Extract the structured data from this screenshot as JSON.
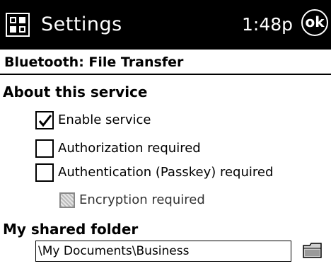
{
  "titlebar": {
    "start_icon": "start-menu-icon",
    "title": "Settings",
    "time": "1:48p",
    "ok_label": "ok"
  },
  "subtitle": "Bluetooth: File Transfer",
  "about": {
    "heading": "About this service",
    "options": [
      {
        "label": "Enable service",
        "checked": true,
        "enabled": true
      },
      {
        "label": "Authorization required",
        "checked": false,
        "enabled": true
      },
      {
        "label": "Authentication (Passkey) required",
        "checked": false,
        "enabled": true
      },
      {
        "label": "Encryption required",
        "checked": false,
        "enabled": false
      }
    ]
  },
  "shared_folder": {
    "heading": "My shared folder",
    "value": "\\My Documents\\Business",
    "browse_icon": "folder-icon"
  }
}
